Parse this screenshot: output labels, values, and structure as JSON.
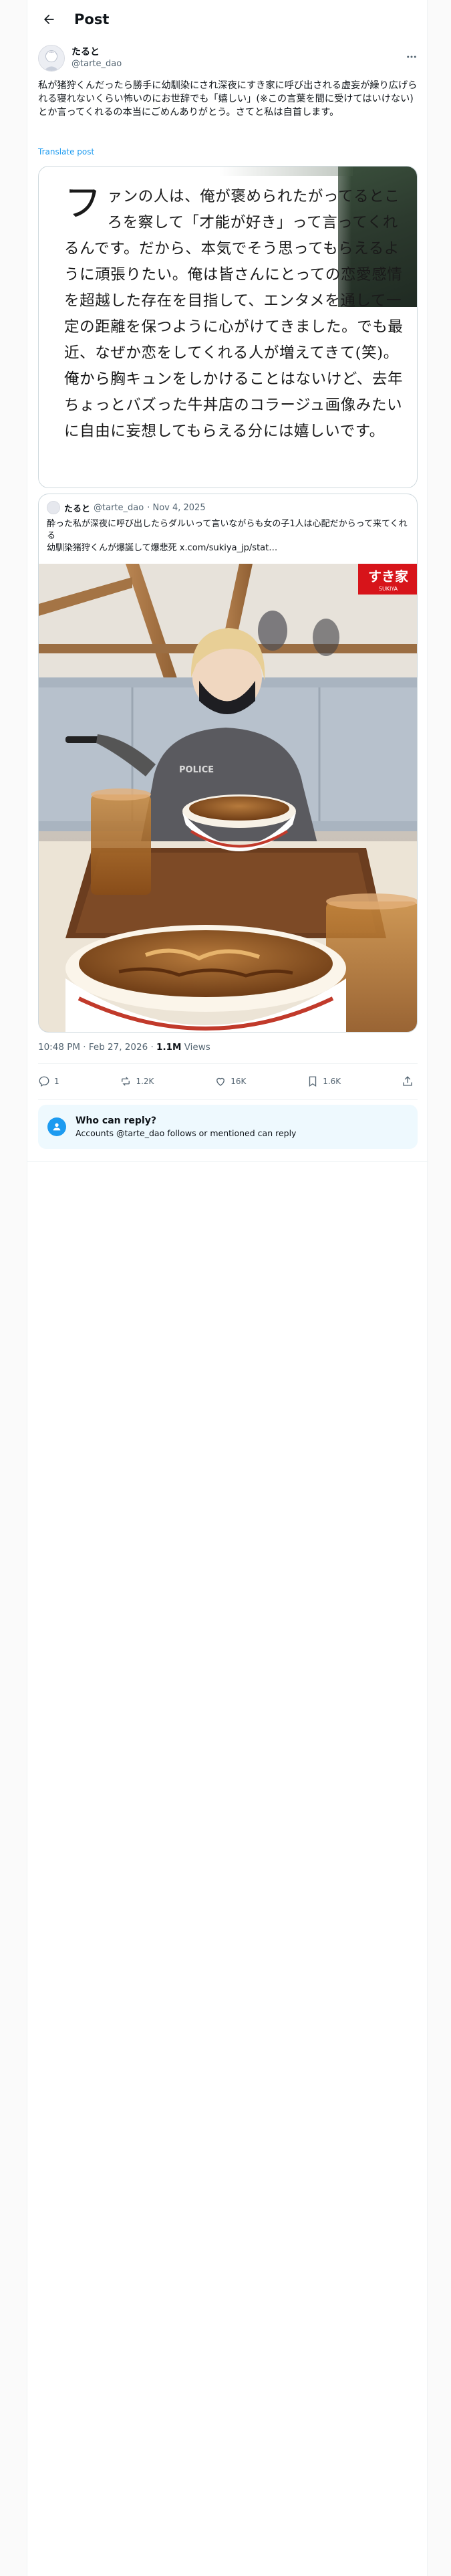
{
  "header": {
    "title": "Post"
  },
  "post": {
    "author": {
      "display_name": "たると",
      "handle": "@tarte_dao"
    },
    "text": "私が猪狩くんだったら勝手に幼馴染にされ深夜にすき家に呼び出される虚妄が繰り広げられる寝れないくらい怖いのにお世辞でも「嬉しい」(※この言葉を間に受けてはいけない)とか言ってくれるの本当にごめんありがとう。さてと私は自首します。",
    "translate_label": "Translate post",
    "image_card": {
      "drop_cap": "フ",
      "text": "ァンの人は、俺が褒められたがってるところを察して「才能が好き」って言ってくれるんです。だから、本気でそう思ってもらえるように頑張りたい。俺は皆さんにとっての恋愛感情を超越した存在を目指して、エンタメを通して一定の距離を保つように心がけてきました。でも最近、なぜか恋をしてくれる人が増えてきて(笑)。俺から胸キュンをしかけることはないけど、去年ちょっとバズった牛丼店のコラージュ画像みたいに自由に妄想してもらえる分には嬉しいです。"
    },
    "quote": {
      "display_name": "たると",
      "handle": "@tarte_dao",
      "date": "· Nov 4, 2025",
      "line1": "酔った私が深夜に呼び出したらダルいって言いながらも女の子1人は心配だからって来てくれる",
      "line2_prefix": "幼馴染猪狩くんが爆誕して爆悲死",
      "line2_link": "x.com/sukiya_jp/stat…",
      "logo_text": "すき家",
      "logo_sub": "SUKIYA"
    },
    "meta": {
      "time_date": "10:48 PM · Feb 27, 2026 · ",
      "views_count": "1.1M",
      "views_label": " Views"
    },
    "actions": {
      "replies": "1",
      "reposts": "1.2K",
      "likes": "16K",
      "bookmarks": "1.6K"
    },
    "who_can_reply": {
      "title": "Who can reply?",
      "subtitle": "Accounts @tarte_dao follows or mentioned can reply"
    }
  },
  "colors": {
    "accent": "#1d9bf0",
    "secondary_text": "#536471",
    "sukiya_red": "#d7141a"
  },
  "icons": [
    "back-arrow-icon",
    "more-icon",
    "reply-icon",
    "repost-icon",
    "like-icon",
    "bookmark-icon",
    "share-icon",
    "people-icon"
  ]
}
